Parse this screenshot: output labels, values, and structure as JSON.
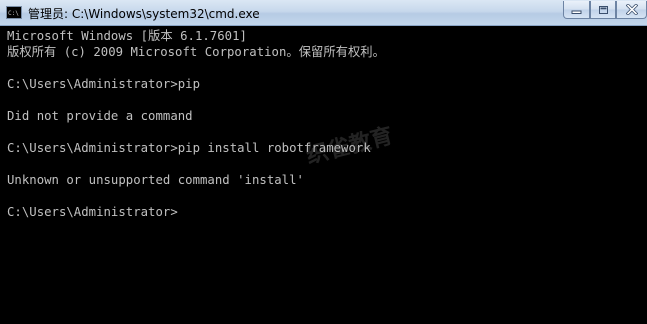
{
  "window": {
    "title": "管理员: C:\\Windows\\system32\\cmd.exe",
    "icon": "cmd-icon",
    "controls": {
      "minimize": "minimize-icon",
      "maximize": "maximize-icon",
      "close": "close-icon"
    }
  },
  "console": {
    "lines": [
      "Microsoft Windows [版本 6.1.7601]",
      "版权所有 (c) 2009 Microsoft Corporation。保留所有权利。",
      "",
      "C:\\Users\\Administrator>pip",
      "",
      "Did not provide a command",
      "",
      "C:\\Users\\Administrator>pip install robotframework",
      "",
      "Unknown or unsupported command 'install'",
      "",
      "C:\\Users\\Administrator>"
    ]
  },
  "watermark": {
    "text": "织雀教育"
  },
  "colors": {
    "console_bg": "#000000",
    "console_fg": "#c0c0c0",
    "titlebar": "#c7d8ec"
  }
}
